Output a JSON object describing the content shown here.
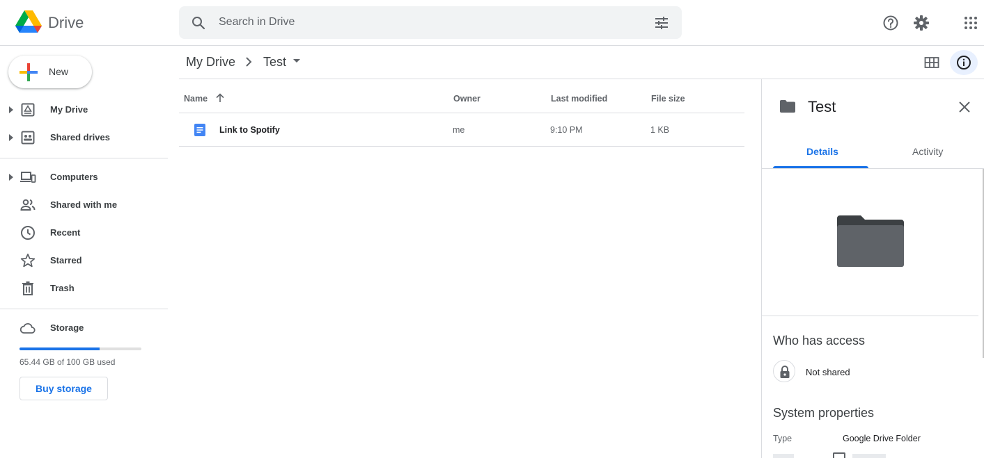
{
  "app": {
    "name": "Drive"
  },
  "search": {
    "placeholder": "Search in Drive"
  },
  "sidebar": {
    "new_label": "New",
    "items": [
      {
        "label": "My Drive",
        "icon": "my-drive-icon",
        "expandable": true
      },
      {
        "label": "Shared drives",
        "icon": "shared-drives-icon",
        "expandable": true
      },
      {
        "label": "Computers",
        "icon": "computers-icon",
        "expandable": true
      },
      {
        "label": "Shared with me",
        "icon": "people-icon",
        "expandable": false
      },
      {
        "label": "Recent",
        "icon": "clock-icon",
        "expandable": false
      },
      {
        "label": "Starred",
        "icon": "star-icon",
        "expandable": false
      },
      {
        "label": "Trash",
        "icon": "trash-icon",
        "expandable": false
      }
    ],
    "storage": {
      "label": "Storage",
      "used_text": "65.44 GB of 100 GB used",
      "used_fraction": 0.6544,
      "buy_label": "Buy storage"
    }
  },
  "breadcrumb": {
    "root": "My Drive",
    "current": "Test"
  },
  "table": {
    "columns": {
      "name": "Name",
      "owner": "Owner",
      "modified": "Last modified",
      "size": "File size"
    },
    "rows": [
      {
        "name": "Link to Spotify",
        "owner": "me",
        "modified": "9:10 PM",
        "size": "1 KB",
        "icon": "google-doc-icon"
      }
    ]
  },
  "details": {
    "title": "Test",
    "tabs": {
      "details": "Details",
      "activity": "Activity"
    },
    "access_heading": "Who has access",
    "access_status": "Not shared",
    "system_heading": "System properties",
    "type_key": "Type",
    "type_value": "Google Drive Folder"
  },
  "colors": {
    "accent": "#1a73e8",
    "text_primary": "#202124",
    "text_secondary": "#5f6368",
    "divider": "#dadce0",
    "search_bg": "#f1f3f4"
  }
}
